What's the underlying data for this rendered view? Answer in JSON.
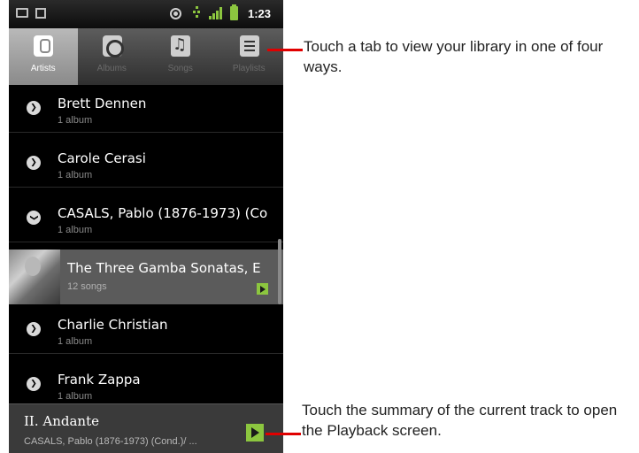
{
  "status_bar": {
    "time": "1:23"
  },
  "tabs": [
    {
      "label": "Artists",
      "icon": "microphone-icon",
      "active": true
    },
    {
      "label": "Albums",
      "icon": "album-icon",
      "active": false
    },
    {
      "label": "Songs",
      "icon": "music-note-icon",
      "active": false
    },
    {
      "label": "Playlists",
      "icon": "playlist-icon",
      "active": false
    }
  ],
  "list": {
    "items": [
      {
        "title": "Brett Dennen",
        "subtitle": "1 album"
      },
      {
        "title": "Carole Cerasi",
        "subtitle": "1 album"
      },
      {
        "title": "CASALS, Pablo (1876-1973) (Co",
        "subtitle": "1 album"
      },
      {
        "title": "Charlie Christian",
        "subtitle": "1 album"
      },
      {
        "title": "Frank Zappa",
        "subtitle": "1 album"
      }
    ],
    "album": {
      "title": "The Three Gamba Sonatas, E",
      "subtitle": "12 songs"
    }
  },
  "now_playing": {
    "title": "II. Andante",
    "artist": "CASALS, Pablo (1876-1973) (Cond.)/ ..."
  },
  "callouts": {
    "tabs": "Touch a tab to view your library in one of four ways.",
    "now_playing": "Touch the summary of the current track to open the Playback screen."
  },
  "colors": {
    "accent": "#8cc63f",
    "callout_line": "#e00000"
  }
}
